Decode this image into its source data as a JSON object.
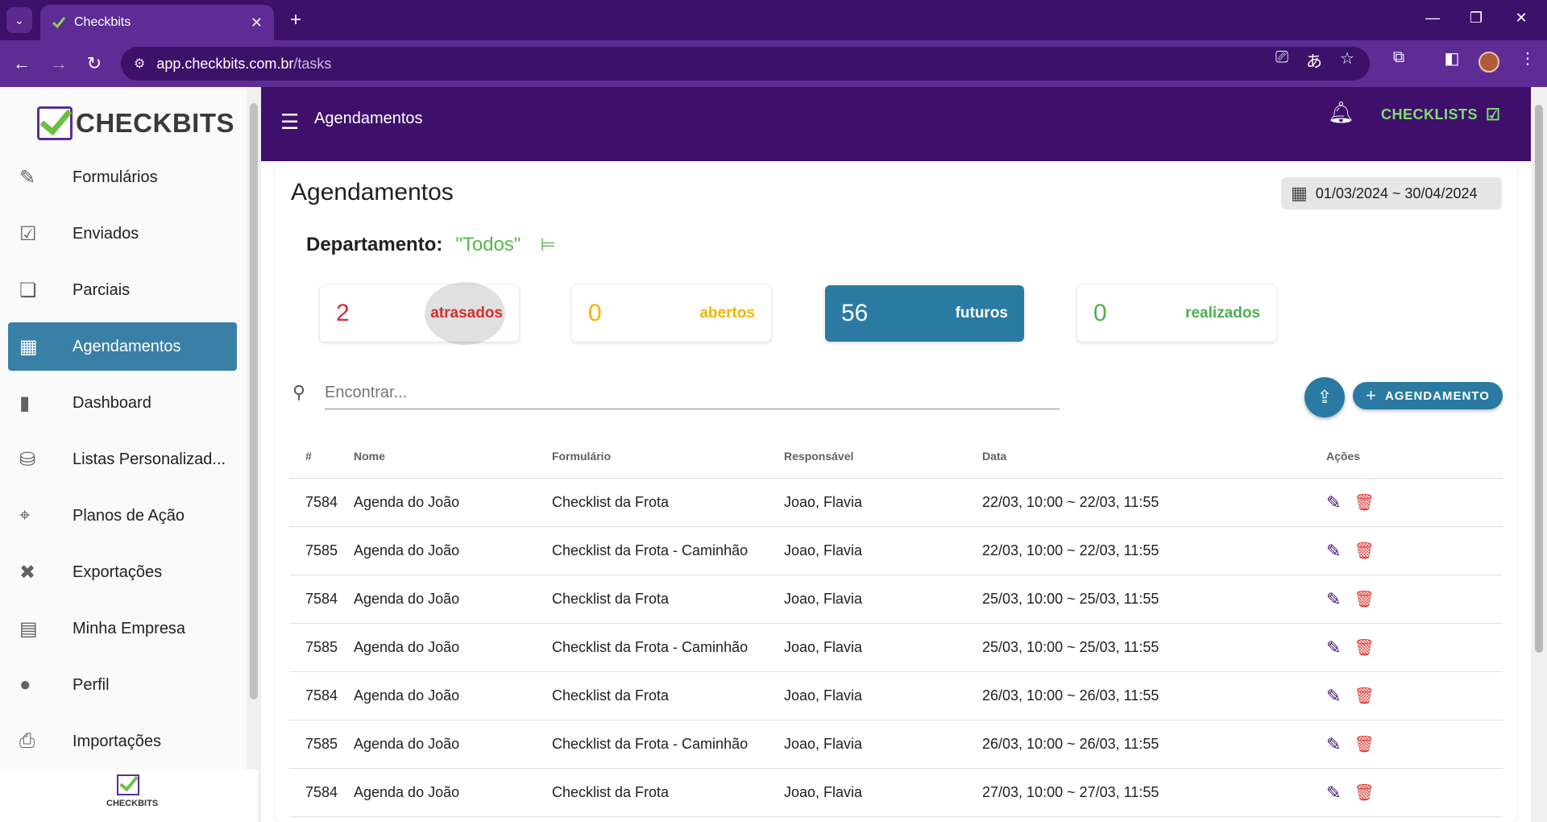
{
  "browser": {
    "tab_title": "Checkbits",
    "url_host": "app.checkbits.com.br",
    "url_path": "/tasks"
  },
  "sidebar": {
    "logo_text": "CHECKBITS",
    "footer_logo_text": "CHECKBITS",
    "items": [
      {
        "label": "Formulários",
        "icon": "form-edit-icon"
      },
      {
        "label": "Enviados",
        "icon": "sent-list-icon"
      },
      {
        "label": "Parciais",
        "icon": "partial-docs-icon"
      },
      {
        "label": "Agendamentos",
        "icon": "calendar-check-icon",
        "active": true
      },
      {
        "label": "Dashboard",
        "icon": "bar-chart-icon"
      },
      {
        "label": "Listas Personalizad...",
        "icon": "database-icon"
      },
      {
        "label": "Planos de Ação",
        "icon": "target-icon"
      },
      {
        "label": "Exportações",
        "icon": "excel-file-icon"
      },
      {
        "label": "Minha Empresa",
        "icon": "building-icon"
      },
      {
        "label": "Perfil",
        "icon": "person-icon"
      },
      {
        "label": "Importações",
        "icon": "file-import-icon"
      }
    ]
  },
  "appbar": {
    "title": "Agendamentos",
    "checklists_label": "CHECKLISTS"
  },
  "main": {
    "title": "Agendamentos",
    "date_range": "01/03/2024 ~ 30/04/2024",
    "department_label": "Departamento:",
    "department_value": "\"Todos\"",
    "stats": [
      {
        "count": "2",
        "label": "atrasados"
      },
      {
        "count": "0",
        "label": "abertos"
      },
      {
        "count": "56",
        "label": "futuros"
      },
      {
        "count": "0",
        "label": "realizados"
      }
    ],
    "search_placeholder": "Encontrar...",
    "add_button_label": "AGENDAMENTO",
    "columns": [
      "#",
      "Nome",
      "Formulário",
      "Responsável",
      "Data",
      "Ações"
    ],
    "rows": [
      {
        "id": "7584",
        "nome": "Agenda do João",
        "formulario": "Checklist da Frota",
        "responsavel": "Joao, Flavia",
        "data": "22/03, 10:00 ~ 22/03, 11:55"
      },
      {
        "id": "7585",
        "nome": "Agenda do João",
        "formulario": "Checklist da Frota - Caminhão",
        "responsavel": "Joao, Flavia",
        "data": "22/03, 10:00 ~ 22/03, 11:55"
      },
      {
        "id": "7584",
        "nome": "Agenda do João",
        "formulario": "Checklist da Frota",
        "responsavel": "Joao, Flavia",
        "data": "25/03, 10:00 ~ 25/03, 11:55"
      },
      {
        "id": "7585",
        "nome": "Agenda do João",
        "formulario": "Checklist da Frota - Caminhão",
        "responsavel": "Joao, Flavia",
        "data": "25/03, 10:00 ~ 25/03, 11:55"
      },
      {
        "id": "7584",
        "nome": "Agenda do João",
        "formulario": "Checklist da Frota",
        "responsavel": "Joao, Flavia",
        "data": "26/03, 10:00 ~ 26/03, 11:55"
      },
      {
        "id": "7585",
        "nome": "Agenda do João",
        "formulario": "Checklist da Frota - Caminhão",
        "responsavel": "Joao, Flavia",
        "data": "26/03, 10:00 ~ 26/03, 11:55"
      },
      {
        "id": "7584",
        "nome": "Agenda do João",
        "formulario": "Checklist da Frota",
        "responsavel": "Joao, Flavia",
        "data": "27/03, 10:00 ~ 27/03, 11:55"
      }
    ]
  },
  "colors": {
    "primary_purple": "#3f0f6c",
    "accent_blue": "#2a7aa3",
    "late_red": "#d32f2f",
    "open_yellow": "#f4b400",
    "done_green": "#4caf50"
  }
}
